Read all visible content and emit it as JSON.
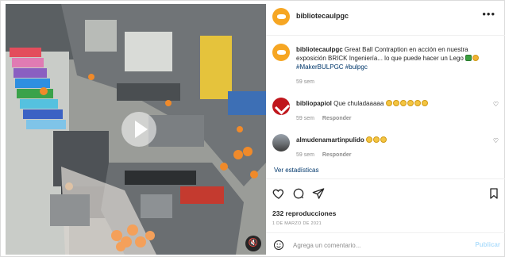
{
  "header": {
    "username": "bibliotecaulpgc",
    "more_icon": "more-horizontal-icon"
  },
  "caption": {
    "username": "bibliotecaulpgc",
    "text": "Great Ball Contraption en acción en nuestra exposición BRICK Ingeniería... lo que puede hacer un Lego",
    "hashtags": "#MakerBULPGC #bulpgc",
    "time": "59 sem"
  },
  "comments": [
    {
      "username": "bibliopapiol",
      "text": "Que chuladaaaaa",
      "emoji_count": 6,
      "time": "59 sem",
      "reply_label": "Responder"
    },
    {
      "username": "almudenamartinpulido",
      "text": "",
      "emoji_count": 3,
      "time": "59 sem",
      "reply_label": "Responder"
    }
  ],
  "stats_link": "Ver estadísticas",
  "views": "232 reproducciones",
  "date": "1 DE MARZO DE 2021",
  "comment_input": {
    "placeholder": "Agrega un comentario...",
    "publish_label": "Publicar"
  },
  "colors": {
    "brand_avatar": "#f6a623",
    "link": "#00376b",
    "publish_disabled": "#b2dffc"
  }
}
